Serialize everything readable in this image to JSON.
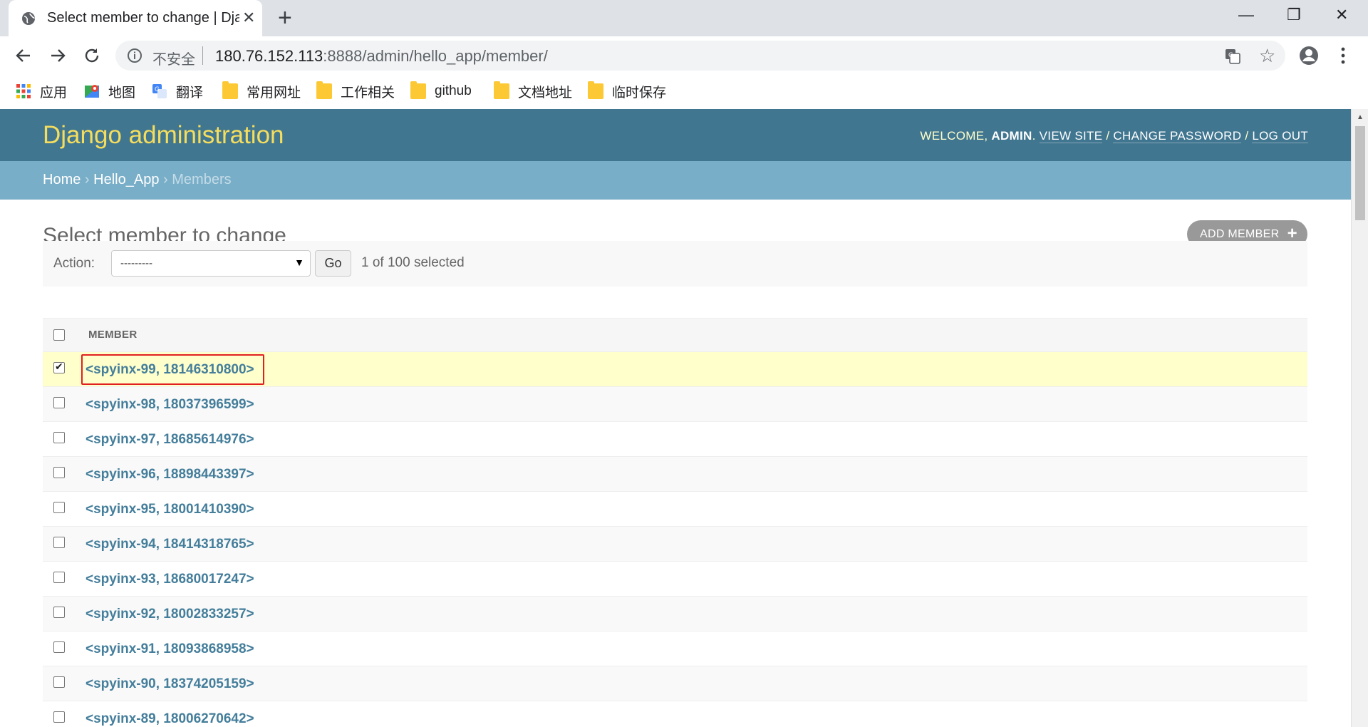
{
  "browser": {
    "tab_title": "Select member to change | Django site admin",
    "url_host": "180.76.152.113",
    "url_rest": ":8888/admin/hello_app/member/",
    "insecure_label": "不安全",
    "new_tab_symbol": "+",
    "close_symbol": "✕",
    "window_buttons": {
      "minimize": "—",
      "restore": "❐",
      "close": "✕"
    },
    "star_symbol": "☆",
    "bookmarks": [
      {
        "label": "应用",
        "icon": "apps-grid-icon"
      },
      {
        "label": "地图",
        "icon": "maps-icon"
      },
      {
        "label": "翻译",
        "icon": "translate-icon"
      },
      {
        "label": "常用网址",
        "icon": "folder-icon"
      },
      {
        "label": "工作相关",
        "icon": "folder-icon"
      },
      {
        "label": "github",
        "icon": "folder-icon"
      },
      {
        "label": "文档地址",
        "icon": "folder-icon"
      },
      {
        "label": "临时保存",
        "icon": "folder-icon"
      }
    ]
  },
  "header": {
    "branding": "Django administration",
    "welcome": "WELCOME,",
    "username": "ADMIN",
    "view_site": "VIEW SITE",
    "change_password": "CHANGE PASSWORD",
    "log_out": "LOG OUT",
    "sep": "/"
  },
  "breadcrumbs": {
    "home": "Home",
    "app": "Hello_App",
    "current": "Members",
    "sep": "›"
  },
  "content": {
    "title": "Select member to change",
    "add_button": "ADD MEMBER",
    "add_icon": "+"
  },
  "actions": {
    "label": "Action:",
    "selected_option": "---------",
    "dropdown_arrow": "▼",
    "go_label": "Go",
    "selection_count": "1 of 100 selected"
  },
  "table": {
    "column_header": "MEMBER",
    "rows": [
      {
        "label": "<spyinx-99, 18146310800>",
        "checked": true
      },
      {
        "label": "<spyinx-98, 18037396599>",
        "checked": false
      },
      {
        "label": "<spyinx-97, 18685614976>",
        "checked": false
      },
      {
        "label": "<spyinx-96, 18898443397>",
        "checked": false
      },
      {
        "label": "<spyinx-95, 18001410390>",
        "checked": false
      },
      {
        "label": "<spyinx-94, 18414318765>",
        "checked": false
      },
      {
        "label": "<spyinx-93, 18680017247>",
        "checked": false
      },
      {
        "label": "<spyinx-92, 18002833257>",
        "checked": false
      },
      {
        "label": "<spyinx-91, 18093868958>",
        "checked": false
      },
      {
        "label": "<spyinx-90, 18374205159>",
        "checked": false
      },
      {
        "label": "<spyinx-89, 18006270642>",
        "checked": false
      }
    ]
  },
  "colors": {
    "header_bg": "#417690",
    "breadcrumb_bg": "#79aec8",
    "branding": "#f5dd5d",
    "link": "#447e9b",
    "selected_row": "#ffffcc",
    "highlight_border": "#e02020"
  }
}
